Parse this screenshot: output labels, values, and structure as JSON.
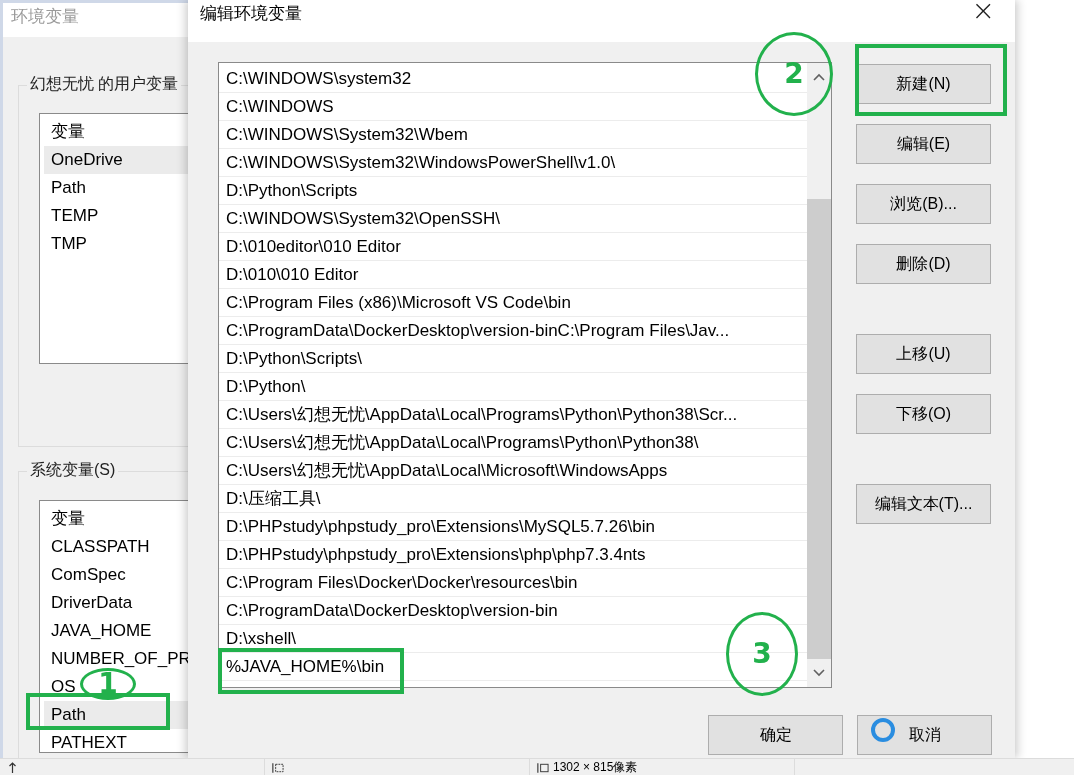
{
  "back_window": {
    "title": "环境变量",
    "user_vars": {
      "label": "幻想无忧 的用户变量",
      "header": "变量",
      "items": [
        {
          "name": "OneDrive",
          "selected": true
        },
        {
          "name": "Path",
          "selected": false
        },
        {
          "name": "TEMP",
          "selected": false
        },
        {
          "name": "TMP",
          "selected": false
        }
      ]
    },
    "system_vars": {
      "label": "系统变量(S)",
      "header": "变量",
      "items": [
        {
          "name": "CLASSPATH",
          "selected": false
        },
        {
          "name": "ComSpec",
          "selected": false
        },
        {
          "name": "DriverData",
          "selected": false
        },
        {
          "name": "JAVA_HOME",
          "selected": false
        },
        {
          "name": "NUMBER_OF_PR",
          "selected": false
        },
        {
          "name": "OS",
          "selected": false
        },
        {
          "name": "Path",
          "selected": true
        },
        {
          "name": "PATHEXT",
          "selected": false
        }
      ]
    }
  },
  "dialog": {
    "title": "编辑环境变量",
    "close": "×",
    "paths": [
      "C:\\WINDOWS\\system32",
      "C:\\WINDOWS",
      "C:\\WINDOWS\\System32\\Wbem",
      "C:\\WINDOWS\\System32\\WindowsPowerShell\\v1.0\\",
      "D:\\Python\\Scripts",
      "C:\\WINDOWS\\System32\\OpenSSH\\",
      "D:\\010editor\\010 Editor",
      "D:\\010\\010 Editor",
      "C:\\Program Files (x86)\\Microsoft VS Code\\bin",
      "C:\\ProgramData\\DockerDesktop\\version-binC:\\Program Files\\Jav...",
      "D:\\Python\\Scripts\\",
      "D:\\Python\\",
      "C:\\Users\\幻想无忧\\AppData\\Local\\Programs\\Python\\Python38\\Scr...",
      "C:\\Users\\幻想无忧\\AppData\\Local\\Programs\\Python\\Python38\\",
      "C:\\Users\\幻想无忧\\AppData\\Local\\Microsoft\\WindowsApps",
      "D:\\压缩工具\\",
      "D:\\PHPstudy\\phpstudy_pro\\Extensions\\MySQL5.7.26\\bin",
      "D:\\PHPstudy\\phpstudy_pro\\Extensions\\php\\php7.3.4nts",
      "C:\\Program Files\\Docker\\Docker\\resources\\bin",
      "C:\\ProgramData\\DockerDesktop\\version-bin",
      "D:\\xshell\\",
      "%JAVA_HOME%\\bin"
    ],
    "side_buttons": [
      {
        "label": "新建(N)",
        "kind": "group1"
      },
      {
        "label": "编辑(E)",
        "kind": "group1"
      },
      {
        "label": "浏览(B)...",
        "kind": "group1"
      },
      {
        "label": "删除(D)",
        "kind": "group1"
      },
      {
        "label": "上移(U)",
        "kind": "group2"
      },
      {
        "label": "下移(O)",
        "kind": "group2"
      },
      {
        "label": "编辑文本(T)...",
        "kind": "group3"
      }
    ],
    "ok": "确定",
    "cancel": "取消"
  },
  "annotations": [
    {
      "kind": "circle",
      "label": "1"
    },
    {
      "kind": "rect"
    },
    {
      "kind": "circle",
      "label": "2"
    },
    {
      "kind": "rect"
    },
    {
      "kind": "circle",
      "label": "3"
    },
    {
      "kind": "rect"
    }
  ],
  "status_bar": {
    "size": "1302 × 815像素"
  }
}
